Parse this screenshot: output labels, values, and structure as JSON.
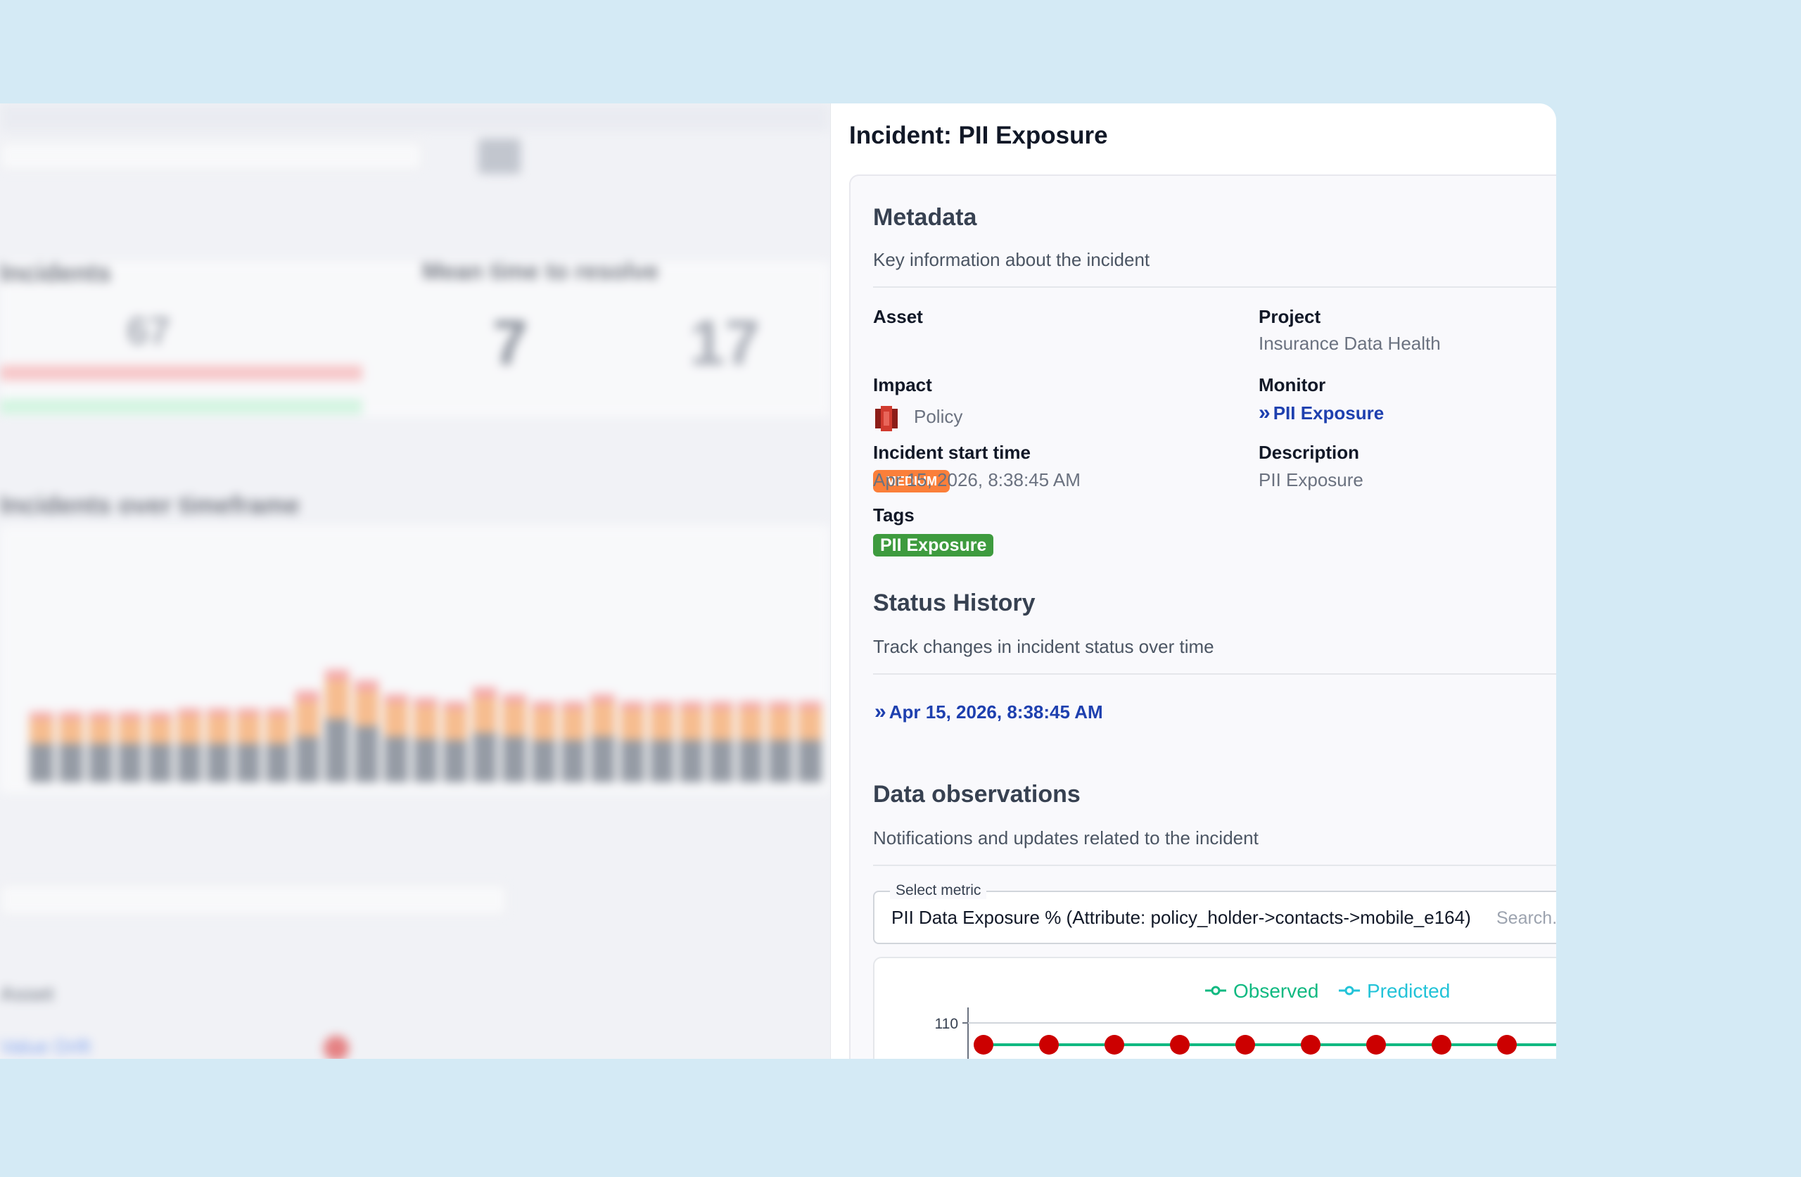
{
  "panel": {
    "title": "Incident: PII Exposure",
    "metadata": {
      "title": "Metadata",
      "subtitle": "Key information about the incident",
      "asset_label": "Asset",
      "asset_value": "Policy",
      "asset_icon": "policy-asset-icon",
      "project_label": "Project",
      "project_value": "Insurance Data Health",
      "impact_label": "Impact",
      "impact_value": "MEDIUM",
      "monitor_label": "Monitor",
      "monitor_value": "PII Exposure",
      "start_label": "Incident start time",
      "start_value": "Apr 15, 2026, 8:38:45 AM",
      "description_label": "Description",
      "description_value": "PII Exposure",
      "tags_label": "Tags",
      "tags": [
        "PII Exposure"
      ]
    },
    "status_history": {
      "title": "Status History",
      "subtitle": "Track changes in incident status over time",
      "entries": [
        "Apr 15, 2026, 8:38:45 AM"
      ]
    },
    "data_observations": {
      "title": "Data observations",
      "subtitle": "Notifications and updates related to the incident",
      "select_label": "Select metric",
      "select_value": "PII Data Exposure % (Attribute: policy_holder->contacts->mobile_e164)",
      "search_placeholder": "Search..."
    }
  },
  "colors": {
    "impact_medium": "#fb7f3a",
    "tag_green": "#3e9b3e",
    "link_blue": "#1e40af",
    "observed": "#10b981",
    "predicted": "#22c3d8",
    "point_red": "#cc0000"
  },
  "chart_data": {
    "type": "line",
    "series": [
      {
        "name": "Observed",
        "values": [
          110,
          110,
          110,
          110,
          110,
          110,
          110,
          110,
          110,
          110
        ]
      },
      {
        "name": "Predicted",
        "values": []
      }
    ],
    "yticks": [
      110
    ],
    "legend": "top-center"
  }
}
